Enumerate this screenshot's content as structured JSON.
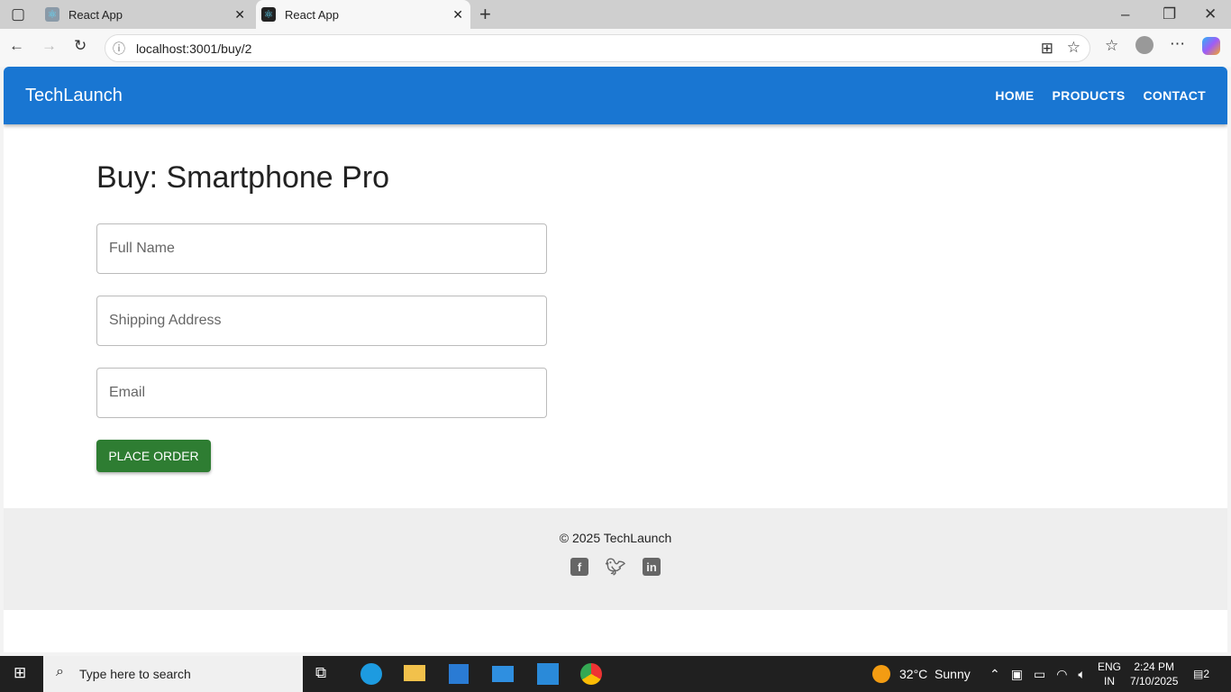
{
  "browser": {
    "tabs": [
      {
        "title": "React App"
      },
      {
        "title": "React App"
      }
    ],
    "url": "localhost:3001/buy/2"
  },
  "app": {
    "brand": "TechLaunch",
    "nav": [
      "HOME",
      "PRODUCTS",
      "CONTACT"
    ]
  },
  "main": {
    "title": "Buy: Smartphone Pro",
    "fields": [
      {
        "placeholder": "Full Name"
      },
      {
        "placeholder": "Shipping Address"
      },
      {
        "placeholder": "Email"
      }
    ],
    "submit": "PLACE ORDER"
  },
  "footer": {
    "copyright": "© 2025 TechLaunch",
    "social": [
      "facebook-icon",
      "twitter-icon",
      "linkedin-icon"
    ]
  },
  "taskbar": {
    "search_placeholder": "Type here to search",
    "weather": "32°C  Sunny",
    "lang1": "ENG",
    "lang2": "IN",
    "time": "2:24 PM",
    "date": "7/10/2025",
    "notifications": "2"
  },
  "colors": {
    "appbar": "#1976d2",
    "button": "#2e7d32"
  }
}
